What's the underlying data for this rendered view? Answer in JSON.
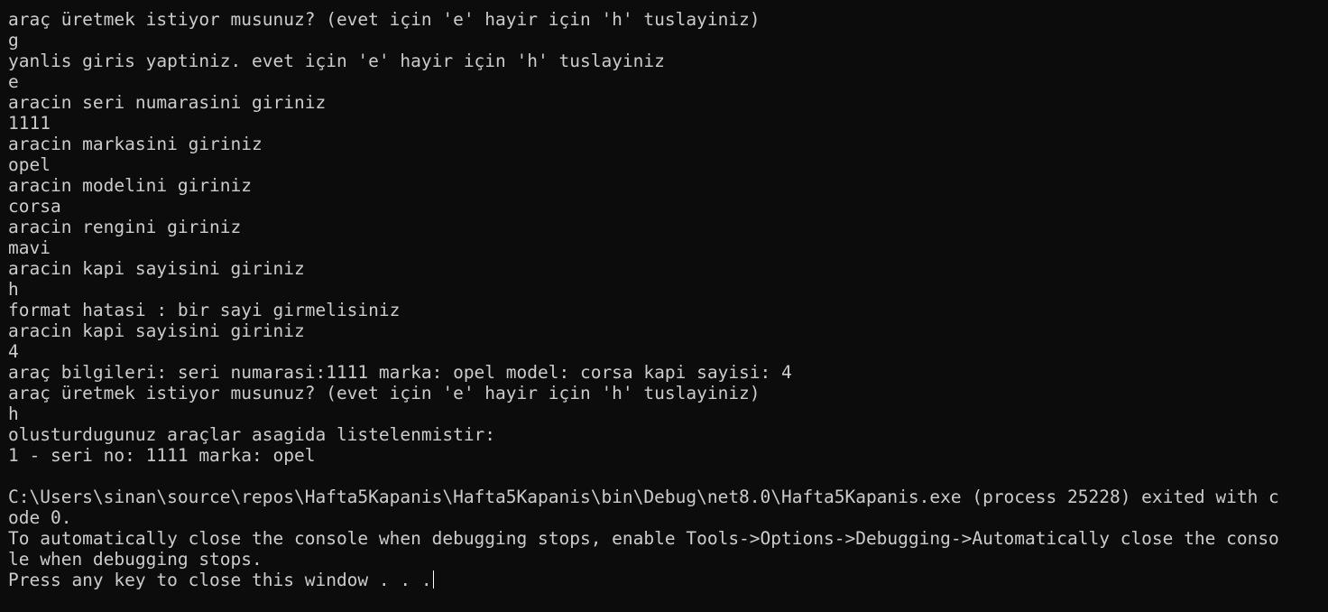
{
  "terminal": {
    "lines": [
      "araç üretmek istiyor musunuz? (evet için 'e' hayir için 'h' tuslayiniz)",
      "g",
      "yanlis giris yaptiniz. evet için 'e' hayir için 'h' tuslayiniz",
      "e",
      "aracin seri numarasini giriniz",
      "1111",
      "aracin markasini giriniz",
      "opel",
      "aracin modelini giriniz",
      "corsa",
      "aracin rengini giriniz",
      "mavi",
      "aracin kapi sayisini giriniz",
      "h",
      "format hatasi : bir sayi girmelisiniz",
      "aracin kapi sayisini giriniz",
      "4",
      "araç bilgileri: seri numarasi:1111 marka: opel model: corsa kapi sayisi: 4",
      "araç üretmek istiyor musunuz? (evet için 'e' hayir için 'h' tuslayiniz)",
      "h",
      "olusturdugunuz araçlar asagida listelenmistir:",
      "1 - seri no: 1111 marka: opel",
      "",
      "C:\\Users\\sinan\\source\\repos\\Hafta5Kapanis\\Hafta5Kapanis\\bin\\Debug\\net8.0\\Hafta5Kapanis.exe (process 25228) exited with c",
      "ode 0.",
      "To automatically close the console when debugging stops, enable Tools->Options->Debugging->Automatically close the conso",
      "le when debugging stops.",
      "Press any key to close this window . . ."
    ]
  },
  "colors": {
    "background": "#0c0c0c",
    "text": "#cccccc",
    "cursor": "#ffffff"
  }
}
